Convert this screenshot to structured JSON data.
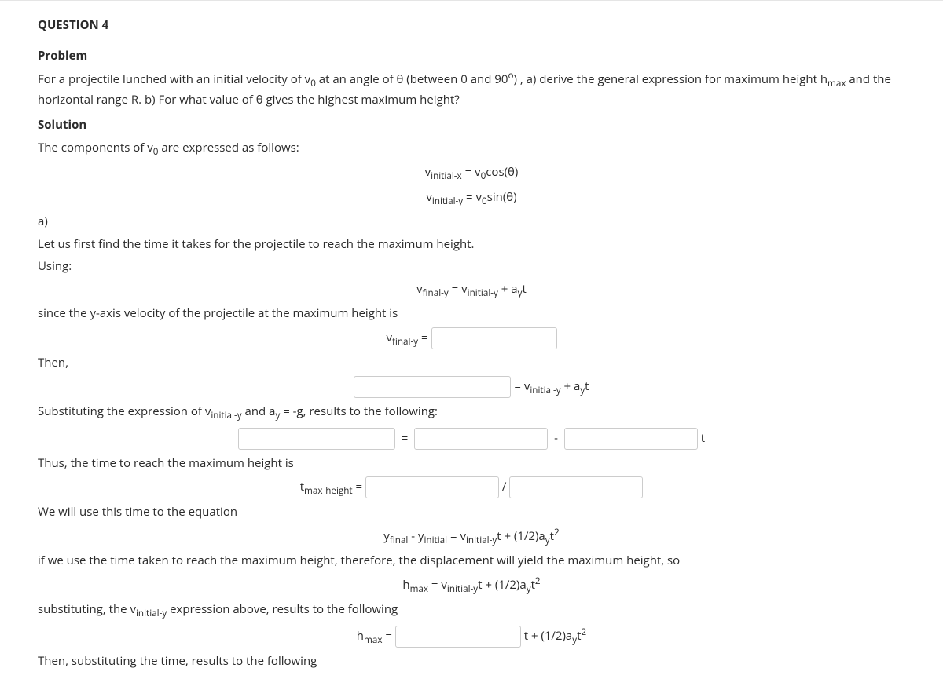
{
  "question_label": "QUESTION 4",
  "headings": {
    "problem": "Problem",
    "solution": "Solution"
  },
  "problem_pre": "For a projectile lunched with an initial velocity of v",
  "problem_mid1": " at an angle of θ (between 0 and 90",
  "problem_mid2": ") , a) derive the general expression for maximum height h",
  "problem_mid3": " and the horizontal range R. b) For what value of θ gives the highest maximum height?",
  "sub0": "0",
  "sub_max": "max",
  "sup_o_small": "o",
  "solution_line1_pre": "The components of v",
  "solution_line1_post": " are expressed as follows:",
  "eq_vx_lhs": "v",
  "eq_vx_sub": "initial-x",
  "eq_vx_rhs_pre": " = v",
  "eq_vx_rhs_post": "cos(θ)",
  "eq_vy_sub": "initial-y",
  "eq_vy_rhs_post": "sin(θ)",
  "part_a": "a)",
  "line_a1": "Let us first find the time it takes for the projectile to reach the maximum height.",
  "line_a2": "Using:",
  "vfinal_y_sub": "final-y",
  "equals": " = ",
  "plus_ayt": " + a",
  "ay_sub": "y",
  "t_char": "t",
  "line_since": "since the y-axis velocity of the projectile at the maximum height is",
  "vfinal_label_pre": "v",
  "line_then": "Then,",
  "eq3_rhs_pre": " = v",
  "line_subst1_pre": "Substituting the expression of v",
  "line_subst1_mid": " and a",
  "line_subst1_post": " = -g, results to the following:",
  "minus": " - ",
  "line_thus": "Thus, the time to reach the maximum height is",
  "tmax_label_pre": "t",
  "tmax_label_sub": "max-height",
  "slash": " / ",
  "line_use_time": "We will use this time to the equation",
  "eq_yfinal_pre": "y",
  "eq_yfinal_sub1": "final",
  "eq_yfinal_sub2": "initial",
  "eq_yfinal_mid": "t + (1/2)a",
  "eq_yfinal_post": "t",
  "sup_2": "2",
  "line_ifwe": "if we use the time taken to reach the maximum height, therefore, the displacement will yield the maximum height, so",
  "hmax_pre": "h",
  "line_subst2": "substituting, the v",
  "line_subst2_post": " expression above, results to the following",
  "line_then_subst": "Then, substituting the time, results to the following"
}
